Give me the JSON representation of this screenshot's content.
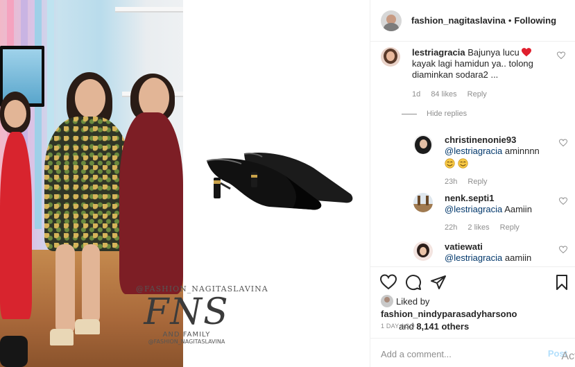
{
  "header": {
    "username": "fashion_nagitaslavina",
    "separator": "•",
    "follow_status": "Following"
  },
  "comments": [
    {
      "username": "lestriagracia",
      "text": "Bajunya lucu",
      "text_after_emoji": "kayak lagi hamidun ya.. tolong diaminkan sodara2 ...",
      "emoji": "red-heart",
      "time": "1d",
      "likes": "84 likes",
      "reply": "Reply"
    }
  ],
  "hide_replies": "Hide replies",
  "replies": [
    {
      "username": "christinenonie93",
      "mention": "@lestriagracia",
      "text": "aminnnn",
      "emoji": "smiling-faces",
      "time": "23h",
      "likes": "",
      "reply": "Reply"
    },
    {
      "username": "nenk.septi1",
      "mention": "@lestriagracia",
      "text": "Aamiin",
      "time": "22h",
      "likes": "2 likes",
      "reply": "Reply"
    },
    {
      "username": "vatiewati",
      "mention": "@lestriagracia",
      "text": "aamiin"
    }
  ],
  "actions": {
    "icons": [
      "heart-icon",
      "comment-icon",
      "share-icon",
      "bookmark-icon"
    ],
    "liked_by_prefix": "Liked by",
    "liked_by_user": "fashion_nindyparasadyharsono",
    "liked_by_and": "and",
    "liked_by_others": "8,141 others",
    "timestamp": "1 DAY AGO"
  },
  "comment_box": {
    "placeholder": "Add a comment...",
    "post_label": "Post",
    "overlay_text": "Acti"
  },
  "watermark": {
    "top": "@FASHION_NAGITASLAVINA",
    "logo": "FNS",
    "bottom": "AND FAMILY",
    "handle": "@FASHION_NAGITASLAVINA"
  },
  "colors": {
    "link": "#00376b",
    "muted": "#8e8e8e",
    "text": "#262626",
    "heart_red": "#ed4956",
    "post_disabled": "#b2dffc"
  }
}
